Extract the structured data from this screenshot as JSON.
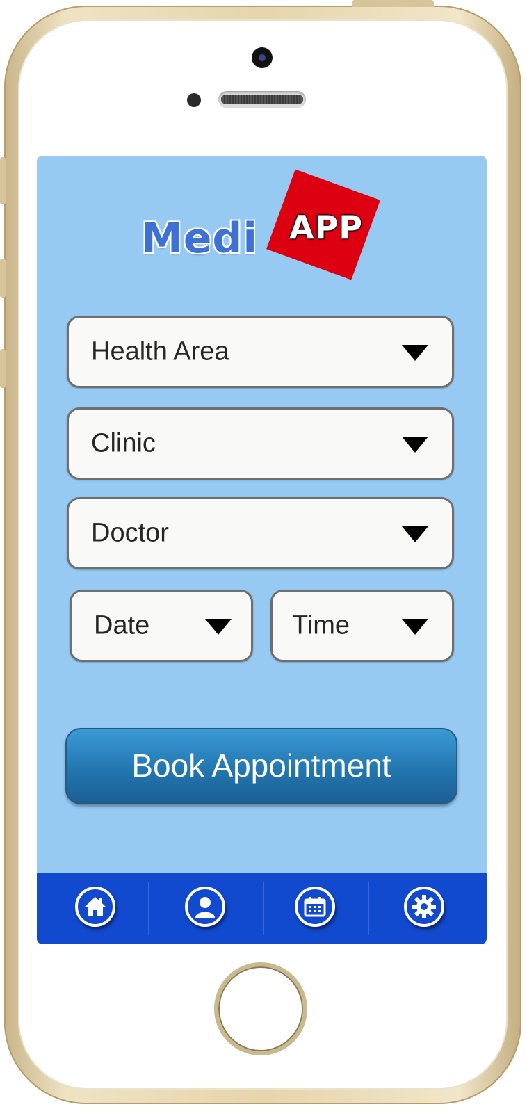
{
  "logo": {
    "medi_text": "Medi",
    "app_text": "APP"
  },
  "form": {
    "health_area": {
      "label": "Health Area"
    },
    "clinic": {
      "label": "Clinic"
    },
    "doctor": {
      "label": "Doctor"
    },
    "date": {
      "label": "Date"
    },
    "time": {
      "label": "Time"
    }
  },
  "book_button": {
    "label": "Book Appointment"
  },
  "tab_bar": {
    "items": [
      {
        "icon": "home-icon"
      },
      {
        "icon": "profile-icon"
      },
      {
        "icon": "calendar-icon"
      },
      {
        "icon": "settings-icon"
      }
    ]
  },
  "colors": {
    "screen_bg": "#97caf3",
    "tab_bar_bg": "#1149cf",
    "book_button": "#2376b0",
    "logo_red": "#dd0010",
    "logo_blue": "#3d71d6"
  }
}
